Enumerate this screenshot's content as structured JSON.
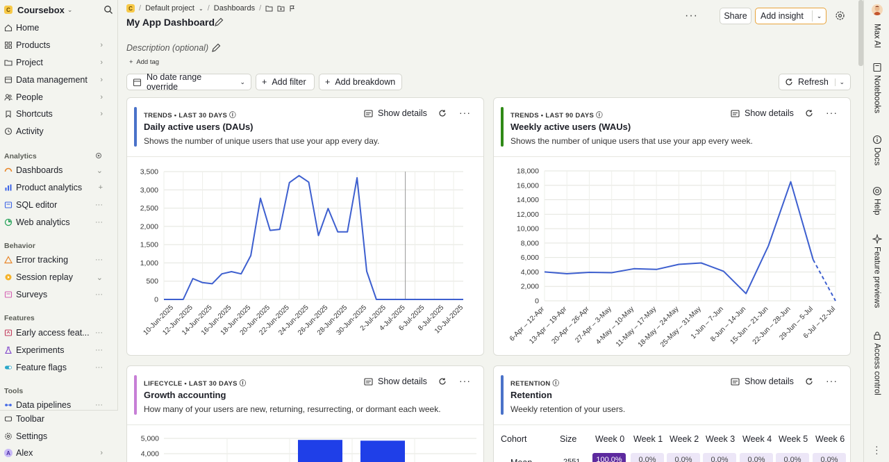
{
  "sidebar": {
    "org": "Coursebox",
    "org_logo": "C",
    "nav": [
      {
        "label": "Home",
        "icon": "home-icon",
        "trail": ""
      },
      {
        "label": "Products",
        "icon": "grid-icon",
        "trail": "›"
      },
      {
        "label": "Project",
        "icon": "folder-icon",
        "trail": "›"
      },
      {
        "label": "Data management",
        "icon": "database-icon",
        "trail": "›"
      },
      {
        "label": "People",
        "icon": "people-icon",
        "trail": "›"
      },
      {
        "label": "Shortcuts",
        "icon": "shortcut-icon",
        "trail": "›"
      },
      {
        "label": "Activity",
        "icon": "clock-icon",
        "trail": ""
      }
    ],
    "sections": {
      "analytics": "Analytics",
      "behavior": "Behavior",
      "features": "Features",
      "tools": "Tools"
    },
    "analytics": [
      {
        "label": "Dashboards",
        "icon": "dashboard-icon",
        "trail": "⌄"
      },
      {
        "label": "Product analytics",
        "icon": "bar-chart-icon",
        "trail": "+"
      },
      {
        "label": "SQL editor",
        "icon": "sql-icon",
        "trail": "···"
      },
      {
        "label": "Web analytics",
        "icon": "web-analytics-icon",
        "trail": "···"
      }
    ],
    "behavior": [
      {
        "label": "Error tracking",
        "icon": "warning-icon",
        "trail": "···"
      },
      {
        "label": "Session replay",
        "icon": "replay-icon",
        "trail": "⌄"
      },
      {
        "label": "Surveys",
        "icon": "survey-icon",
        "trail": "···"
      }
    ],
    "features": [
      {
        "label": "Early access feat...",
        "icon": "rocket-icon",
        "trail": "···"
      },
      {
        "label": "Experiments",
        "icon": "flask-icon",
        "trail": "···"
      },
      {
        "label": "Feature flags",
        "icon": "toggle-icon",
        "trail": "···"
      }
    ],
    "tools": [
      {
        "label": "Data pipelines",
        "icon": "pipeline-icon",
        "trail": "···"
      }
    ],
    "bottom": [
      {
        "label": "Toolbar",
        "icon": "toolbar-icon"
      },
      {
        "label": "Settings",
        "icon": "gear-icon"
      },
      {
        "label": "Alex",
        "icon": "avatar"
      }
    ],
    "avatar_letter": "A"
  },
  "header": {
    "project_logo": "C",
    "project": "Default project",
    "section": "Dashboards",
    "title": "My App Dashboard",
    "share": "Share",
    "add_insight": "Add insight",
    "description_placeholder": "Description (optional)",
    "add_tag": "Add tag",
    "date_range": "No date range override",
    "add_filter": "Add filter",
    "add_breakdown": "Add breakdown",
    "refresh": "Refresh"
  },
  "cards": {
    "dau": {
      "kicker": "TRENDS • LAST 30 DAYS",
      "title": "Daily active users (DAUs)",
      "subtitle": "Shows the number of unique users that use your app every day.",
      "details": "Show details",
      "color": "#4a72c9"
    },
    "wau": {
      "kicker": "TRENDS • LAST 90 DAYS",
      "title": "Weekly active users (WAUs)",
      "subtitle": "Shows the number of unique users that use your app every week.",
      "details": "Show details",
      "color": "#2f8a17"
    },
    "lifecycle": {
      "kicker": "LIFECYCLE • LAST 30 DAYS",
      "title": "Growth accounting",
      "subtitle": "How many of your users are new, returning, resurrecting, or dormant each week.",
      "details": "Show details",
      "color": "#c77fd6"
    },
    "retention": {
      "kicker": "RETENTION",
      "title": "Retention",
      "subtitle": "Weekly retention of your users.",
      "details": "Show details",
      "color": "#4a72c9"
    }
  },
  "chart_data": [
    {
      "type": "line",
      "x": [
        "9-Jun-2025",
        "10-Jun-2025",
        "11-Jun-2025",
        "12-Jun-2025",
        "13-Jun-2025",
        "14-Jun-2025",
        "15-Jun-2025",
        "16-Jun-2025",
        "17-Jun-2025",
        "18-Jun-2025",
        "19-Jun-2025",
        "20-Jun-2025",
        "21-Jun-2025",
        "22-Jun-2025",
        "23-Jun-2025",
        "24-Jun-2025",
        "25-Jun-2025",
        "26-Jun-2025",
        "27-Jun-2025",
        "28-Jun-2025",
        "29-Jun-2025",
        "30-Jun-2025",
        "1-Jul-2025",
        "2-Jul-2025",
        "3-Jul-2025",
        "4-Jul-2025",
        "5-Jul-2025",
        "6-Jul-2025",
        "7-Jul-2025",
        "8-Jul-2025",
        "9-Jul-2025",
        "10-Jul-2025"
      ],
      "tick_labels": [
        "10-Jun-2025",
        "12-Jun-2025",
        "14-Jun-2025",
        "16-Jun-2025",
        "18-Jun-2025",
        "20-Jun-2025",
        "22-Jun-2025",
        "24-Jun-2025",
        "26-Jun-2025",
        "28-Jun-2025",
        "30-Jun-2025",
        "2-Jul-2025",
        "4-Jul-2025",
        "6-Jul-2025",
        "8-Jul-2025",
        "10-Jul-2025"
      ],
      "values": [
        0,
        0,
        0,
        570,
        460,
        430,
        700,
        760,
        700,
        1200,
        2770,
        1890,
        1920,
        3200,
        3390,
        3210,
        1750,
        2490,
        1850,
        1850,
        3330,
        770,
        0,
        0,
        0,
        0,
        0,
        0,
        0,
        0,
        0,
        0
      ],
      "ylim": [
        0,
        3500
      ],
      "yticks": [
        "3,500",
        "3,000",
        "2,500",
        "2,000",
        "1,500",
        "1,000",
        "500",
        "0"
      ],
      "grid": true,
      "color": "#3d5fcf"
    },
    {
      "type": "line",
      "x": [
        "6-Apr – 12-Apr",
        "13-Apr – 19-Apr",
        "20-Apr – 26-Apr",
        "27-Apr – 3-May",
        "4-May – 10-May",
        "11-May – 17-May",
        "18-May – 24-May",
        "25-May – 31-May",
        "1-Jun – 7-Jun",
        "8-Jun – 14-Jun",
        "15-Jun – 21-Jun",
        "22-Jun – 28-Jun",
        "29-Jun – 5-Jul",
        "6-Jul – 12-Jul"
      ],
      "values": [
        4000,
        3750,
        3950,
        3900,
        4450,
        4350,
        5050,
        5250,
        4100,
        1000,
        7600,
        16500,
        5700,
        0
      ],
      "ylim": [
        0,
        18000
      ],
      "yticks": [
        "18,000",
        "16,000",
        "14,000",
        "12,000",
        "10,000",
        "8,000",
        "6,000",
        "4,000",
        "2,000",
        "0"
      ],
      "grid": true,
      "color": "#3d5fcf"
    },
    {
      "type": "bar",
      "yticks": [
        "5,000",
        "4,000"
      ],
      "ylim": [
        0,
        5000
      ],
      "series": [
        {
          "values": [
            4900,
            4850
          ]
        }
      ],
      "grid": true,
      "color": "#1f3fe8"
    }
  ],
  "retention": {
    "headers": [
      "Cohort",
      "Size",
      "Week 0",
      "Week 1",
      "Week 2",
      "Week 3",
      "Week 4",
      "Week 5",
      "Week 6"
    ],
    "row": {
      "cohort": "Mean",
      "size": "2551",
      "cells": [
        "100.0%",
        "0.0%",
        "0.0%",
        "0.0%",
        "0.0%",
        "0.0%",
        "0.0%"
      ]
    }
  },
  "rail": [
    "Max AI",
    "Notebooks",
    "Docs",
    "Help",
    "Feature previews",
    "Access control"
  ]
}
